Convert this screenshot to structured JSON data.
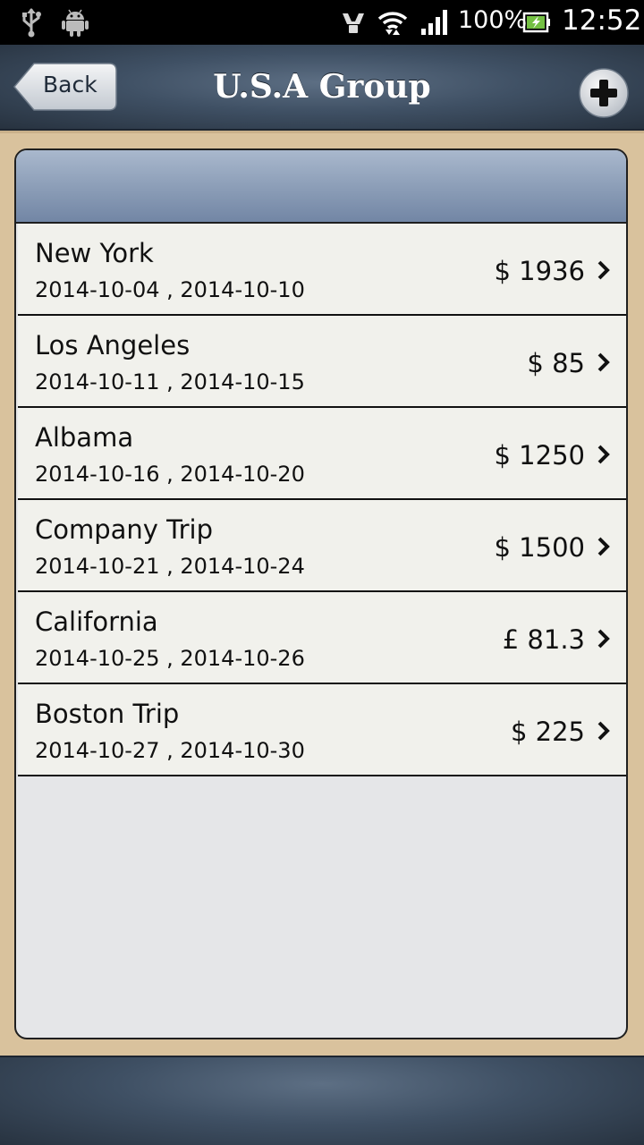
{
  "status_bar": {
    "battery_percent": "100%",
    "time": "12:52",
    "icons": [
      "usb-icon",
      "android-debug-icon",
      "vibrate-icon",
      "wifi-icon",
      "signal-icon",
      "battery-icon"
    ]
  },
  "nav": {
    "back_label": "Back",
    "title": "U.S.A Group",
    "add_icon": "plus-circle-icon"
  },
  "trips": [
    {
      "name": "New York",
      "dates": "2014-10-04 , 2014-10-10",
      "amount": "$ 1936"
    },
    {
      "name": "Los Angeles",
      "dates": "2014-10-11 , 2014-10-15",
      "amount": "$ 85"
    },
    {
      "name": "Albama",
      "dates": "2014-10-16 , 2014-10-20",
      "amount": "$ 1250"
    },
    {
      "name": "Company Trip",
      "dates": "2014-10-21 , 2014-10-24",
      "amount": "$ 1500"
    },
    {
      "name": "California",
      "dates": "2014-10-25 , 2014-10-26",
      "amount": "£ 81.3"
    },
    {
      "name": "Boston Trip",
      "dates": "2014-10-27 , 2014-10-30",
      "amount": "$ 225"
    }
  ],
  "colors": {
    "nav_bar": "#3f5064",
    "content_background": "#d9c29d",
    "row_background": "#f1f1ec",
    "panel_header": "#8a9cb6"
  }
}
